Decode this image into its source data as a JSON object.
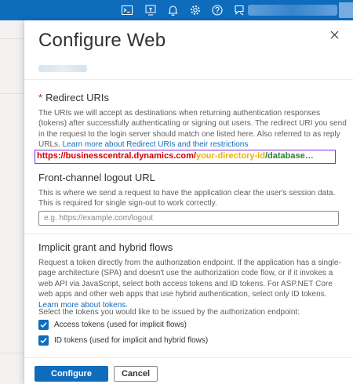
{
  "topbar": {
    "icons": [
      "cloud-shell-icon",
      "directory-filter-icon",
      "bell-icon",
      "gear-icon",
      "help-icon",
      "feedback-icon"
    ]
  },
  "panel": {
    "title": "Configure Web",
    "close_icon": "close-icon",
    "redirect": {
      "required_mark": "*",
      "heading": "Redirect URIs",
      "description": "The URIs we will accept as destinations when returning authentication responses (tokens) after successfully authenticating or signing out users. The redirect URI you send in the request to the login server should match one listed here. Also referred to as reply URLs.",
      "link": "Learn more about Redirect URIs and their restrictions",
      "uri_part1": "https://businesscentral.dynamics.com/",
      "uri_part2": "your-directory-id",
      "uri_part3": "/database…"
    },
    "logout": {
      "heading": "Front-channel logout URL",
      "description": "This is where we send a request to have the application clear the user's session data. This is required for single sign-out to work correctly.",
      "placeholder": "e.g. https://example.com/logout",
      "value": ""
    },
    "implicit": {
      "heading": "Implicit grant and hybrid flows",
      "description": "Request a token directly from the authorization endpoint. If the application has a single-page architecture (SPA) and doesn't use the authorization code flow, or if it invokes a web API via JavaScript, select both access tokens and ID tokens. For ASP.NET Core web apps and other web apps that use hybrid authentication, select only ID tokens.",
      "link": "Learn more about tokens.",
      "select_prompt": "Select the tokens you would like to be issued by the authorization endpoint:",
      "access_tokens_label": "Access tokens (used for implicit flows)",
      "access_tokens_checked": true,
      "id_tokens_label": "ID tokens (used for implicit and hybrid flows)",
      "id_tokens_checked": true
    },
    "footer": {
      "configure_label": "Configure",
      "cancel_label": "Cancel"
    }
  },
  "colors": {
    "brand": "#0f6cbd",
    "required": "#a4262c",
    "uri_red": "#d10000",
    "uri_yellow": "#e8b400",
    "uri_green": "#2e7d32",
    "uri_border": "#8a2be2"
  }
}
